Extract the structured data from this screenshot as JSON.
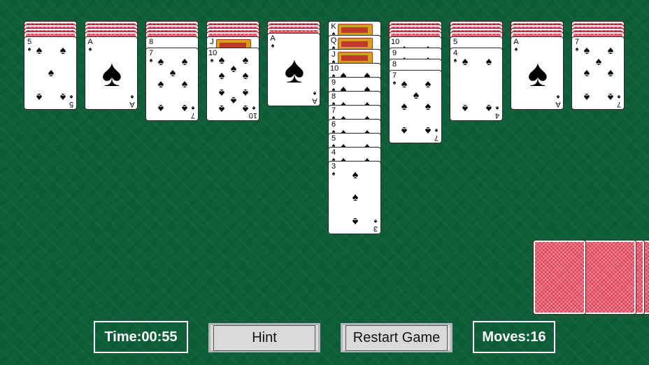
{
  "game": "Spider Solitaire",
  "tableau": [
    {
      "hidden": 4,
      "up": [
        {
          "rank": "5",
          "suit": "♠"
        }
      ]
    },
    {
      "hidden": 4,
      "up": [
        {
          "rank": "A",
          "suit": "♠"
        }
      ]
    },
    {
      "hidden": 4,
      "up": [
        {
          "rank": "8",
          "suit": "♠"
        },
        {
          "rank": "7",
          "suit": "♠"
        }
      ]
    },
    {
      "hidden": 4,
      "up": [
        {
          "rank": "J",
          "suit": "♠"
        },
        {
          "rank": "10",
          "suit": "♠"
        }
      ]
    },
    {
      "hidden": 3,
      "up": [
        {
          "rank": "A",
          "suit": "♠"
        }
      ]
    },
    {
      "hidden": 0,
      "up": [
        {
          "rank": "K",
          "suit": "♠"
        },
        {
          "rank": "Q",
          "suit": "♠"
        },
        {
          "rank": "J",
          "suit": "♠"
        },
        {
          "rank": "10",
          "suit": "♠"
        },
        {
          "rank": "9",
          "suit": "♠"
        },
        {
          "rank": "8",
          "suit": "♠"
        },
        {
          "rank": "7",
          "suit": "♠"
        },
        {
          "rank": "6",
          "suit": "♠"
        },
        {
          "rank": "5",
          "suit": "♠"
        },
        {
          "rank": "4",
          "suit": "♠"
        },
        {
          "rank": "3",
          "suit": "♠"
        }
      ]
    },
    {
      "hidden": 4,
      "up": [
        {
          "rank": "10",
          "suit": "♠"
        },
        {
          "rank": "9",
          "suit": "♠"
        },
        {
          "rank": "8",
          "suit": "♠"
        },
        {
          "rank": "7",
          "suit": "♠"
        }
      ]
    },
    {
      "hidden": 4,
      "up": [
        {
          "rank": "5",
          "suit": "♠"
        },
        {
          "rank": "4",
          "suit": "♠"
        }
      ]
    },
    {
      "hidden": 4,
      "up": [
        {
          "rank": "A",
          "suit": "♠"
        }
      ]
    },
    {
      "hidden": 4,
      "up": [
        {
          "rank": "7",
          "suit": "♠"
        }
      ]
    }
  ],
  "stock_piles": 5,
  "hud": {
    "time_label": "Time:00:55",
    "hint_label": "Hint",
    "restart_label": "Restart Game",
    "moves_label": "Moves:16"
  },
  "colors": {
    "felt": "#0f5e3a",
    "card_back": "#e0445a",
    "button_grey": "#d9d9d9"
  }
}
